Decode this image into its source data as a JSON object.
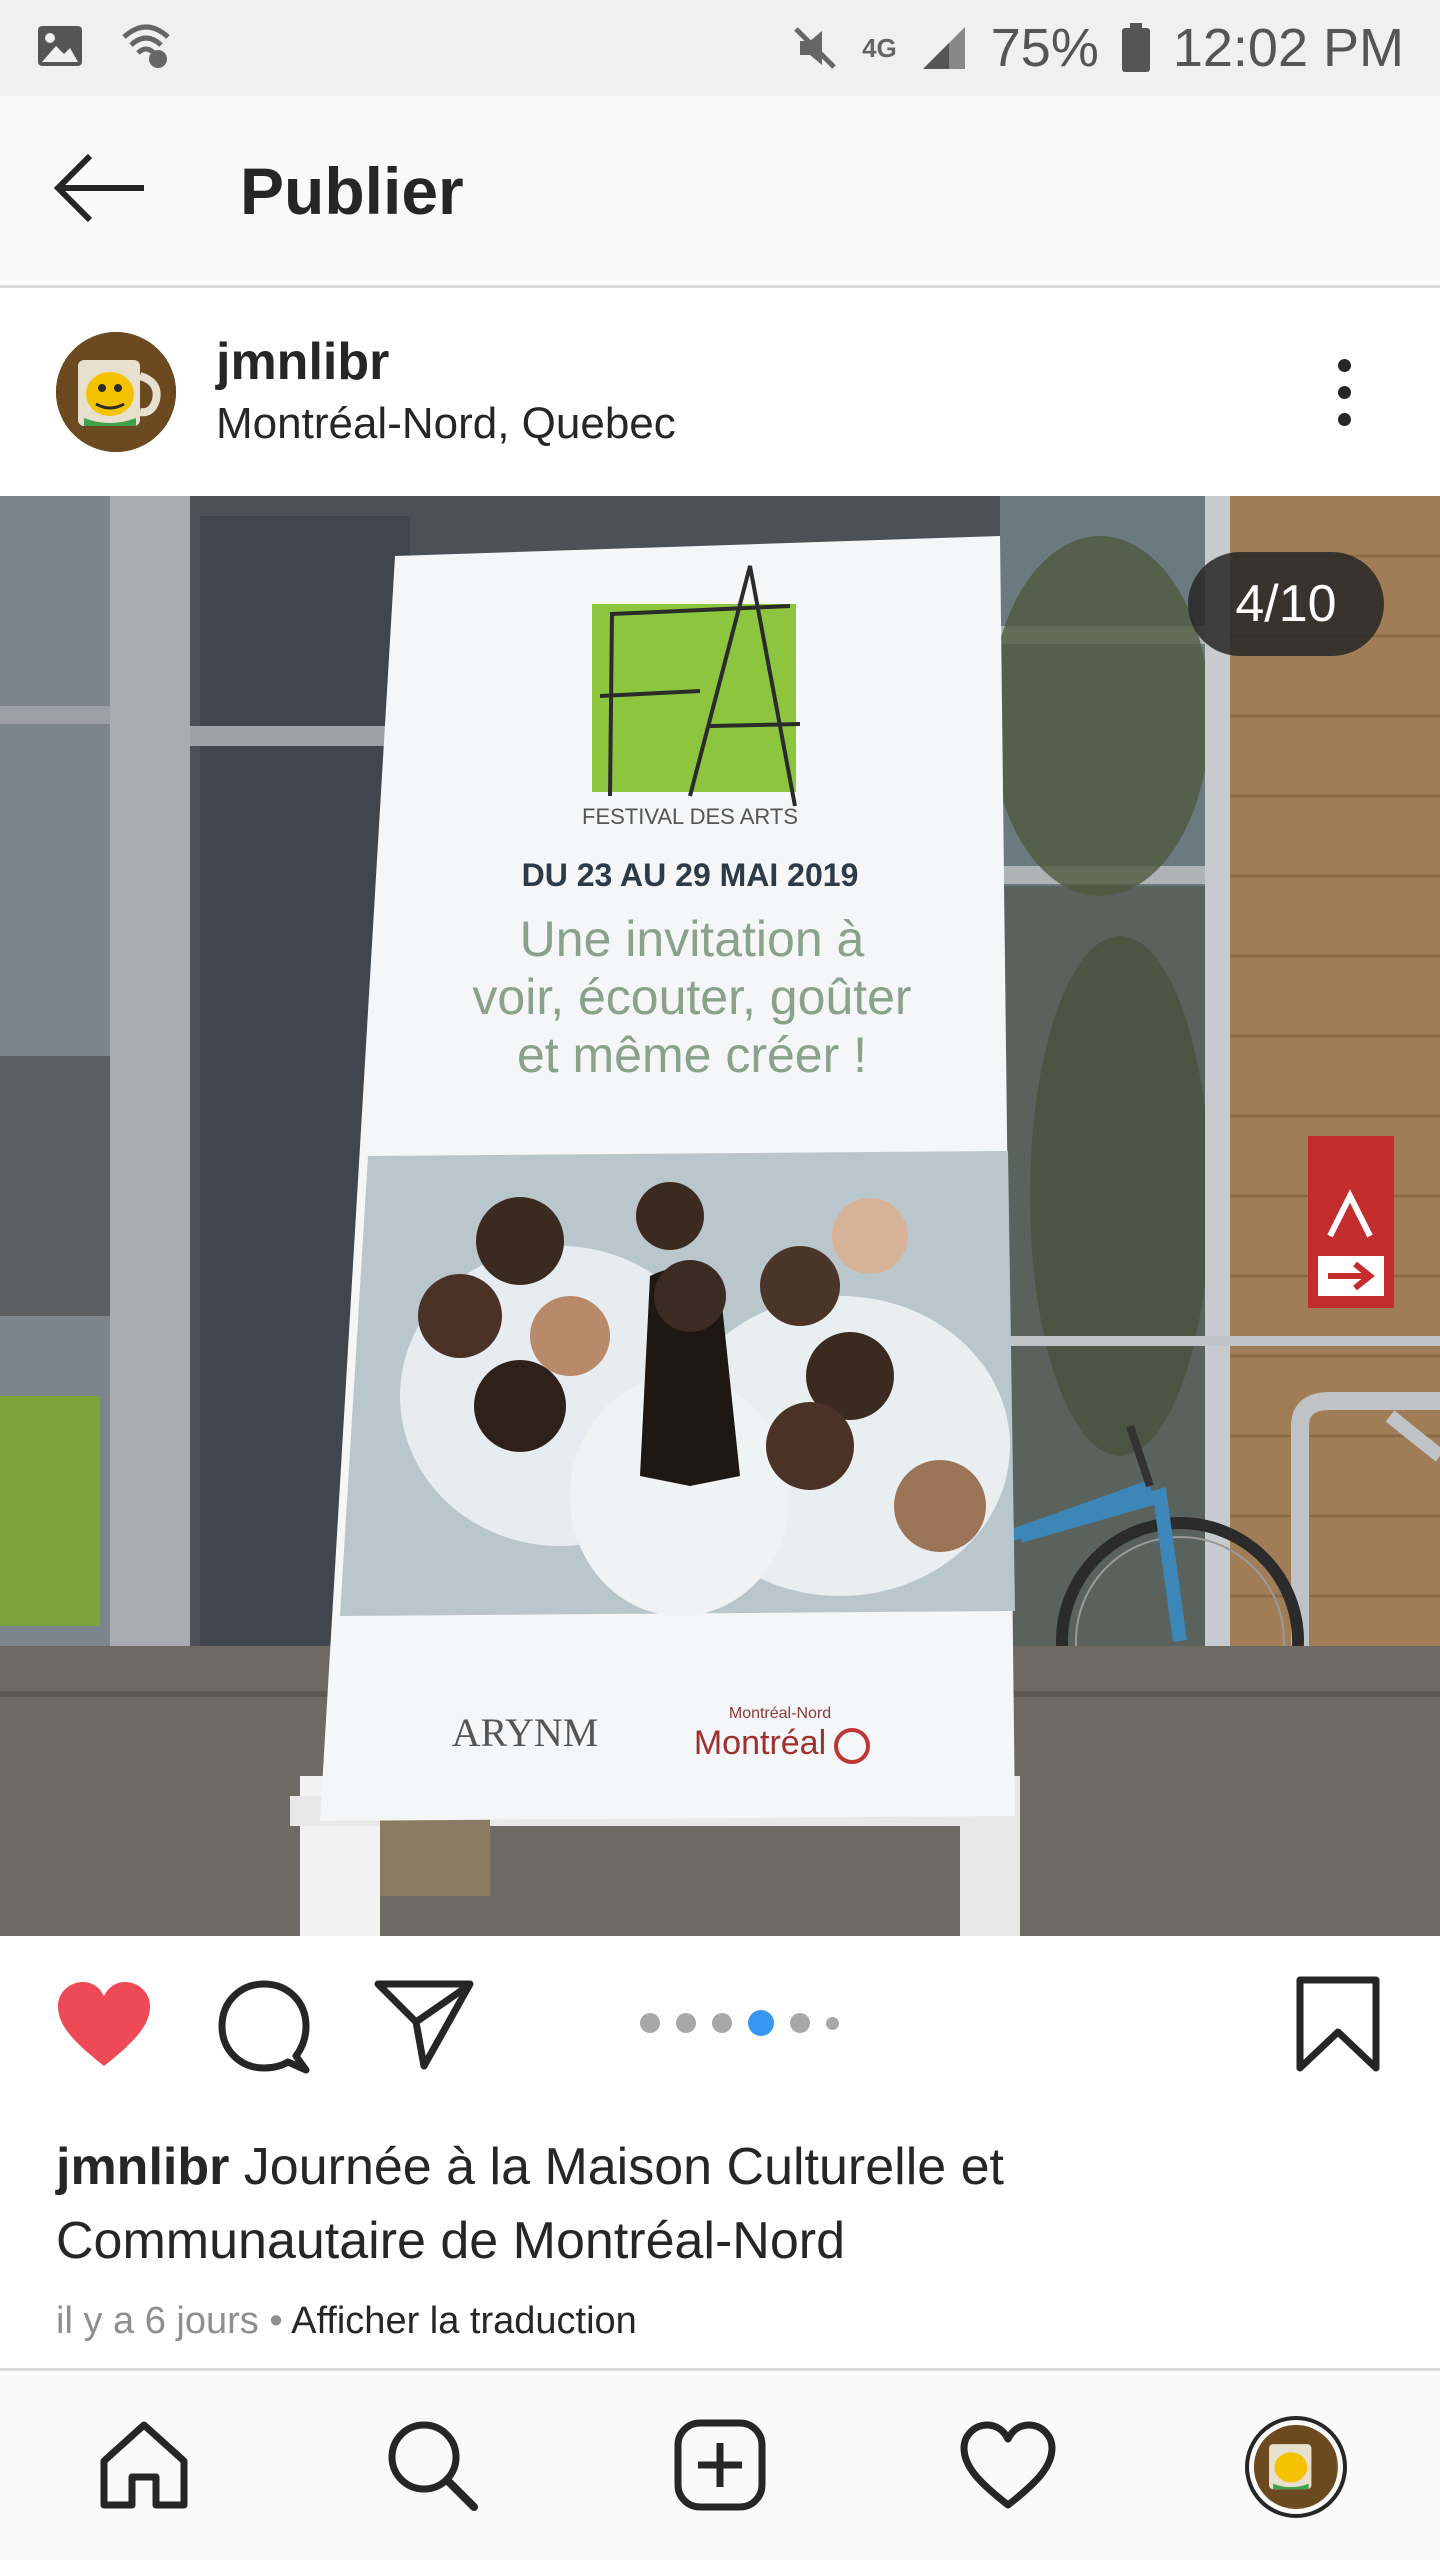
{
  "status_bar": {
    "battery": "75%",
    "time": "12:02 PM",
    "network": "4G"
  },
  "app_bar": {
    "title": "Publier"
  },
  "post": {
    "username": "jmnlibr",
    "location": "Montréal-Nord, Quebec",
    "image_counter": "4/10",
    "poster": {
      "logo_letters": "FA",
      "festival": "FESTIVAL DES ARTS",
      "dates": "DU 23 AU 29 MAI 2019",
      "tagline_1": "Une invitation à",
      "tagline_2": "voir, écouter, goûter",
      "tagline_3": "et même créer !",
      "sponsor_1": "ARYNM",
      "sponsor_2_small": "Montréal-Nord",
      "sponsor_2": "Montréal"
    },
    "carousel_dots": 6,
    "carousel_active": 4,
    "caption_user": "jmnlibr",
    "caption_text": "Journée à la Maison Culturelle et Communautaire de Montréal-Nord",
    "time_ago": "il y a 6 jours",
    "separator": "•",
    "translate_label": "Afficher la traduction"
  },
  "colors": {
    "like": "#ed4956",
    "active_dot": "#3897f0",
    "festival_green": "#8cc63f"
  },
  "icons": {
    "back": "arrow-left-icon",
    "more": "more-vertical-icon",
    "like": "heart-filled-icon",
    "comment": "comment-icon",
    "share": "send-icon",
    "save": "bookmark-icon",
    "home": "home-icon",
    "search": "search-icon",
    "add": "add-post-icon",
    "activity": "heart-outline-icon"
  }
}
